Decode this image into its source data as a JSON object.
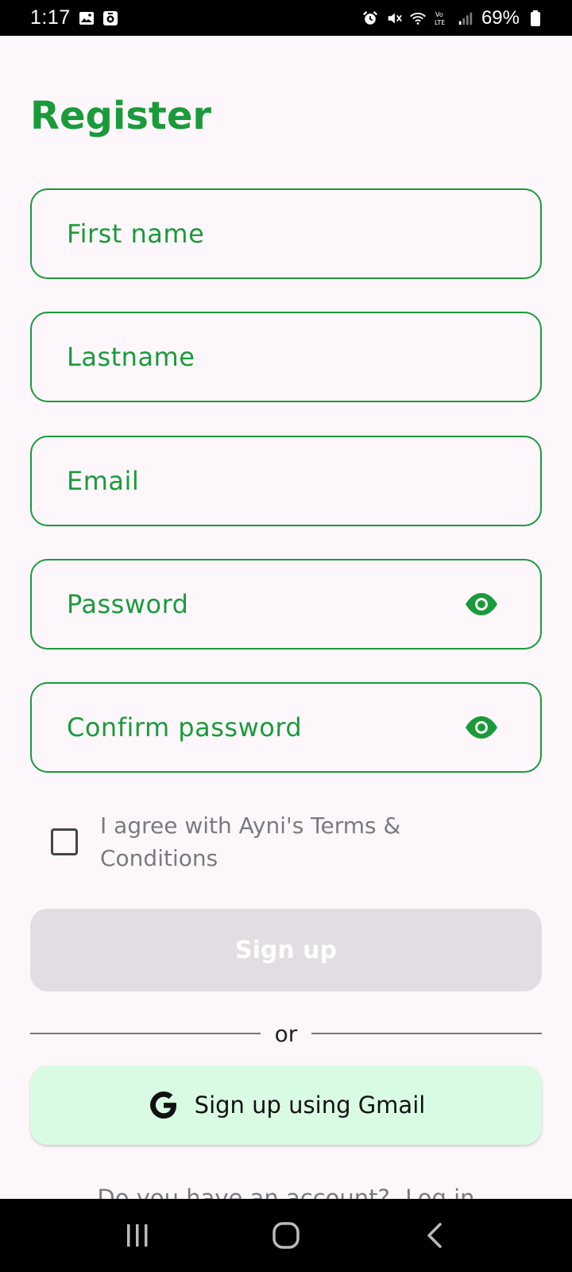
{
  "status_bar": {
    "time": "1:17",
    "battery": "69%",
    "left_icons": [
      "image-icon",
      "media-icon"
    ],
    "right_icons": [
      "alarm-icon",
      "mute-icon",
      "wifi-icon",
      "volte-icon",
      "signal-icon",
      "battery-icon"
    ]
  },
  "page": {
    "title": "Register"
  },
  "form": {
    "first_name": {
      "placeholder": "First name"
    },
    "last_name": {
      "placeholder": "Lastname"
    },
    "email": {
      "placeholder": "Email"
    },
    "password": {
      "placeholder": "Password",
      "toggle_icon": "eye-icon"
    },
    "confirm_password": {
      "placeholder": "Confirm password",
      "toggle_icon": "eye-icon"
    },
    "terms": {
      "label": "I agree with Ayni's Terms & Conditions",
      "checked": false
    }
  },
  "actions": {
    "signup_label": "Sign up",
    "divider_label": "or",
    "gmail_label": "Sign up using Gmail",
    "login_prompt": "Do you have an account?",
    "login_link": "Log in"
  },
  "colors": {
    "accent": "#1a9b3a",
    "background": "#fdf7fc",
    "disabled_button": "#e3dde3",
    "gmail_button": "#d9fbe3"
  },
  "nav_bar": {
    "buttons": [
      "recents-icon",
      "home-icon",
      "back-icon"
    ]
  }
}
